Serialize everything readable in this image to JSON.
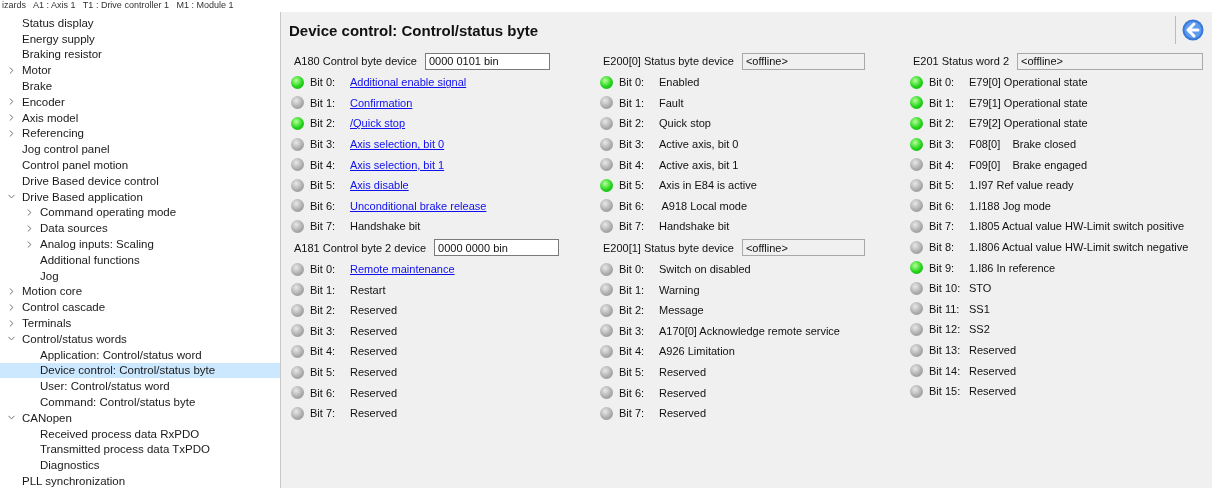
{
  "breadcrumb": "izards   A1 : Axis 1   T1 : Drive controller 1   M1 : Module 1",
  "tree": [
    {
      "label": "Status display",
      "selected": false
    },
    {
      "label": "Energy supply",
      "selected": false
    },
    {
      "label": "Braking resistor",
      "selected": false
    },
    {
      "label": "Motor",
      "selected": false,
      "expanded": false
    },
    {
      "label": "Brake",
      "selected": false
    },
    {
      "label": "Encoder",
      "selected": false,
      "expanded": false
    },
    {
      "label": "Axis model",
      "selected": false,
      "expanded": false
    },
    {
      "label": "Referencing",
      "selected": false,
      "expanded": false
    },
    {
      "label": "Jog control panel",
      "selected": false
    },
    {
      "label": "Control panel motion",
      "selected": false
    },
    {
      "label": "Drive Based device control",
      "selected": false
    },
    {
      "label": "Drive Based application",
      "selected": false,
      "expanded": true,
      "children": [
        {
          "label": "Command operating mode",
          "selected": false,
          "expanded": false
        },
        {
          "label": "Data sources",
          "selected": false,
          "expanded": false
        },
        {
          "label": "Analog inputs: Scaling",
          "selected": false,
          "expanded": false
        },
        {
          "label": "Additional functions",
          "selected": false
        },
        {
          "label": "Jog",
          "selected": false
        }
      ]
    },
    {
      "label": "Motion core",
      "selected": false,
      "expanded": false
    },
    {
      "label": "Control cascade",
      "selected": false,
      "expanded": false
    },
    {
      "label": "Terminals",
      "selected": false,
      "expanded": false
    },
    {
      "label": "Control/status words",
      "selected": false,
      "expanded": true,
      "children": [
        {
          "label": "Application: Control/status word",
          "selected": false
        },
        {
          "label": "Device control: Control/status byte",
          "selected": true
        },
        {
          "label": "User: Control/status word",
          "selected": false
        },
        {
          "label": "Command: Control/status byte",
          "selected": false
        }
      ]
    },
    {
      "label": "CANopen",
      "selected": false,
      "expanded": true,
      "children": [
        {
          "label": "Received process data RxPDO",
          "selected": false
        },
        {
          "label": "Transmitted process data TxPDO",
          "selected": false
        },
        {
          "label": "Diagnostics",
          "selected": false
        }
      ]
    },
    {
      "label": "PLL synchronization",
      "selected": false
    }
  ],
  "title": "Device control: Control/status byte",
  "columns": [
    {
      "groups": [
        {
          "label": "A180 Control byte device",
          "value": "0000 0101 bin",
          "readonly": false,
          "bits": [
            {
              "bit": "Bit 0:",
              "text": "Additional enable signal",
              "on": true,
              "kind": "link"
            },
            {
              "bit": "Bit 1:",
              "text": "Confirmation",
              "on": false,
              "kind": "link"
            },
            {
              "bit": "Bit 2:",
              "text": "/Quick stop",
              "on": true,
              "kind": "link"
            },
            {
              "bit": "Bit 3:",
              "text": "Axis selection, bit 0",
              "on": false,
              "kind": "link"
            },
            {
              "bit": "Bit 4:",
              "text": "Axis selection, bit 1",
              "on": false,
              "kind": "link"
            },
            {
              "bit": "Bit 5:",
              "text": "Axis disable",
              "on": false,
              "kind": "link"
            },
            {
              "bit": "Bit 6:",
              "text": "Unconditional brake release",
              "on": false,
              "kind": "link"
            },
            {
              "bit": "Bit 7:",
              "text": "Handshake bit",
              "on": false,
              "kind": "text"
            }
          ]
        },
        {
          "label": "A181 Control byte 2 device",
          "value": "0000 0000 bin",
          "readonly": false,
          "bits": [
            {
              "bit": "Bit 0:",
              "text": "Remote maintenance",
              "on": false,
              "kind": "link"
            },
            {
              "bit": "Bit 1:",
              "text": "Restart",
              "on": false,
              "kind": "text"
            },
            {
              "bit": "Bit 2:",
              "text": "Reserved",
              "on": false,
              "kind": "text"
            },
            {
              "bit": "Bit 3:",
              "text": "Reserved",
              "on": false,
              "kind": "text"
            },
            {
              "bit": "Bit 4:",
              "text": "Reserved",
              "on": false,
              "kind": "text"
            },
            {
              "bit": "Bit 5:",
              "text": "Reserved",
              "on": false,
              "kind": "text"
            },
            {
              "bit": "Bit 6:",
              "text": "Reserved",
              "on": false,
              "kind": "text"
            },
            {
              "bit": "Bit 7:",
              "text": "Reserved",
              "on": false,
              "kind": "text"
            }
          ]
        }
      ]
    },
    {
      "groups": [
        {
          "label": "E200[0] Status byte device",
          "value": "<offline>",
          "readonly": true,
          "bits": [
            {
              "bit": "Bit 0:",
              "text": "Enabled",
              "on": true,
              "kind": "text"
            },
            {
              "bit": "Bit 1:",
              "text": "Fault",
              "on": false,
              "kind": "text"
            },
            {
              "bit": "Bit 2:",
              "text": "Quick stop",
              "on": false,
              "kind": "text"
            },
            {
              "bit": "Bit 3:",
              "text": "Active axis, bit 0",
              "on": false,
              "kind": "text"
            },
            {
              "bit": "Bit 4:",
              "text": "Active axis, bit 1",
              "on": false,
              "kind": "text"
            },
            {
              "bit": "Bit 5:",
              "text": "Axis in E84 is active",
              "on": true,
              "kind": "text"
            },
            {
              "bit": "Bit 6:",
              "text": " A918 Local mode",
              "on": false,
              "kind": "text"
            },
            {
              "bit": "Bit 7:",
              "text": "Handshake bit",
              "on": false,
              "kind": "text"
            }
          ]
        },
        {
          "label": "E200[1] Status byte device",
          "value": "<offline>",
          "readonly": true,
          "bits": [
            {
              "bit": "Bit 0:",
              "text": "Switch on disabled",
              "on": false,
              "kind": "text"
            },
            {
              "bit": "Bit 1:",
              "text": "Warning",
              "on": false,
              "kind": "text"
            },
            {
              "bit": "Bit 2:",
              "text": "Message",
              "on": false,
              "kind": "text"
            },
            {
              "bit": "Bit 3:",
              "text": "A170[0] Acknowledge remote service",
              "on": false,
              "kind": "text"
            },
            {
              "bit": "Bit 4:",
              "text": "A926 Limitation",
              "on": false,
              "kind": "text"
            },
            {
              "bit": "Bit 5:",
              "text": "Reserved",
              "on": false,
              "kind": "text"
            },
            {
              "bit": "Bit 6:",
              "text": "Reserved",
              "on": false,
              "kind": "text"
            },
            {
              "bit": "Bit 7:",
              "text": "Reserved",
              "on": false,
              "kind": "text"
            }
          ]
        }
      ]
    },
    {
      "groups": [
        {
          "label": "E201 Status word 2",
          "value": "<offline>",
          "readonly": true,
          "bits": [
            {
              "bit": "Bit 0:",
              "text": "E79[0] Operational state",
              "on": true,
              "kind": "text"
            },
            {
              "bit": "Bit 1:",
              "text": "E79[1] Operational state",
              "on": true,
              "kind": "text"
            },
            {
              "bit": "Bit 2:",
              "text": "E79[2] Operational state",
              "on": true,
              "kind": "text"
            },
            {
              "bit": "Bit 3:",
              "text": "F08[0]    Brake closed",
              "on": true,
              "kind": "text"
            },
            {
              "bit": "Bit 4:",
              "text": "F09[0]    Brake engaged",
              "on": false,
              "kind": "text"
            },
            {
              "bit": "Bit 5:",
              "text": "1.I97 Ref value ready",
              "on": false,
              "kind": "text"
            },
            {
              "bit": "Bit 6:",
              "text": "1.I188 Jog mode",
              "on": false,
              "kind": "text"
            },
            {
              "bit": "Bit 7:",
              "text": "1.I805 Actual value HW-Limit switch positive",
              "on": false,
              "kind": "text"
            },
            {
              "bit": "Bit 8:",
              "text": "1.I806 Actual value HW-Limit switch negative",
              "on": false,
              "kind": "text"
            },
            {
              "bit": "Bit 9:",
              "text": "1.I86 In reference",
              "on": true,
              "kind": "text"
            },
            {
              "bit": "Bit 10:",
              "text": "STO",
              "on": false,
              "kind": "text"
            },
            {
              "bit": "Bit 11:",
              "text": "SS1",
              "on": false,
              "kind": "text"
            },
            {
              "bit": "Bit 12:",
              "text": "SS2",
              "on": false,
              "kind": "text"
            },
            {
              "bit": "Bit 13:",
              "text": "Reserved",
              "on": false,
              "kind": "text"
            },
            {
              "bit": "Bit 14:",
              "text": "Reserved",
              "on": false,
              "kind": "text"
            },
            {
              "bit": "Bit 15:",
              "text": "Reserved",
              "on": false,
              "kind": "text"
            }
          ]
        }
      ]
    }
  ]
}
